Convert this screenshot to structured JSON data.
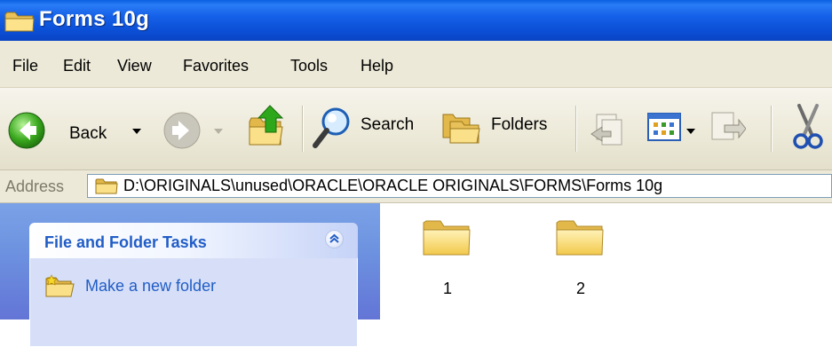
{
  "window": {
    "title": "Forms 10g"
  },
  "menu": [
    "File",
    "Edit",
    "View",
    "Favorites",
    "Tools",
    "Help"
  ],
  "toolbar": {
    "back_label": "Back",
    "search_label": "Search",
    "folders_label": "Folders",
    "icons": [
      "back-icon",
      "dropdown-arrow-icon",
      "forward-icon",
      "up-folder-icon",
      "search-icon",
      "folders-icon",
      "move-to-icon",
      "views-icon",
      "copy-to-icon",
      "cut-icon"
    ]
  },
  "address": {
    "label": "Address",
    "path": "D:\\ORIGINALS\\unused\\ORACLE\\ORACLE ORIGINALS\\FORMS\\Forms 10g"
  },
  "task_pane": {
    "group_title": "File and Folder Tasks",
    "links": [
      {
        "label": "Make a new folder"
      }
    ]
  },
  "files": [
    {
      "name": "1",
      "icon": "folder-icon"
    },
    {
      "name": "2",
      "icon": "folder-icon"
    }
  ],
  "colors": {
    "titlebar": "#0b4fd6",
    "chrome": "#ece9d8",
    "task_pane_bg": "#6d93e0",
    "task_link": "#215dc6"
  }
}
